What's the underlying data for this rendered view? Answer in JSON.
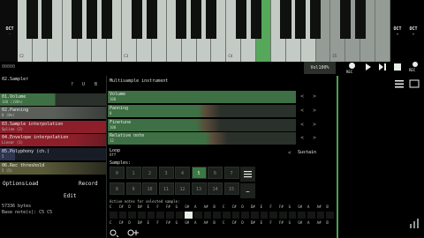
{
  "keyboard": {
    "octave_left_label": "OCT",
    "octave_left_value": "-",
    "octave_right_label": "OCT",
    "octave_right_value": "+",
    "octave_right_value2": "+",
    "key_labels": [
      "C2",
      "C3",
      "C4",
      "C5"
    ]
  },
  "transport": {
    "time_value": "00000",
    "volume": "Vol100%",
    "rec_label": "REC",
    "rec2_label": "REC"
  },
  "left_panel": {
    "instrument_title": "02.Sampler",
    "header_icons": [
      "?",
      "U",
      "B"
    ],
    "params": [
      {
        "title": "01.Volume",
        "sub": "100 (100%)"
      },
      {
        "title": "02.Panning",
        "sub": "0 (0%)"
      },
      {
        "title": "03.Sample interpolation",
        "sub": "Spline (2)"
      },
      {
        "title": "04.Envelope interpolation",
        "sub": "Linear (1)"
      },
      {
        "title": "05.Polyphony (ch.)",
        "sub": "5"
      },
      {
        "title": "06.Rec threshold",
        "sub": "5 (5)"
      }
    ],
    "options_label": "Options",
    "load_label": "Load",
    "record_label": "Record",
    "edit_label": "Edit",
    "bytes_label": "57336 bytes",
    "base_note": "Base note(s): C5 C5"
  },
  "center_panel": {
    "title": "Multisample instrument",
    "sliders": [
      {
        "title": "Volume",
        "sub": "100"
      },
      {
        "title": "Panning",
        "sub": "0"
      },
      {
        "title": "Finetune",
        "sub": "100"
      },
      {
        "title": "Relative note",
        "sub": "12"
      }
    ],
    "arrow_left": "<",
    "arrow_right": ">",
    "loop_label": "Loop",
    "loop_value": "Off",
    "loop_mode": "Sustain",
    "samples_label": "Samples:",
    "sample_numbers_row1": [
      "0",
      "1",
      "2",
      "3",
      "4",
      "5",
      "6",
      "7"
    ],
    "sample_numbers_row2": [
      "8",
      "9",
      "10",
      "11",
      "12",
      "13",
      "14",
      "15"
    ],
    "selected_sample": "5",
    "active_notes_label": "Active notes for selected sample:",
    "note_letters": [
      "C",
      "C#",
      "D",
      "D#",
      "E",
      "F",
      "F#",
      "G",
      "G#",
      "A",
      "A#",
      "B",
      "C",
      "C#",
      "D",
      "D#",
      "E",
      "F",
      "F#",
      "G",
      "G#",
      "A",
      "A#",
      "B"
    ],
    "active_note_index": 8
  },
  "colors": {
    "accent_green": "#55a85a",
    "slider_green": "#3f6f44",
    "red_param": "#8c1f2a",
    "grey_param": "#5a5f5a"
  }
}
